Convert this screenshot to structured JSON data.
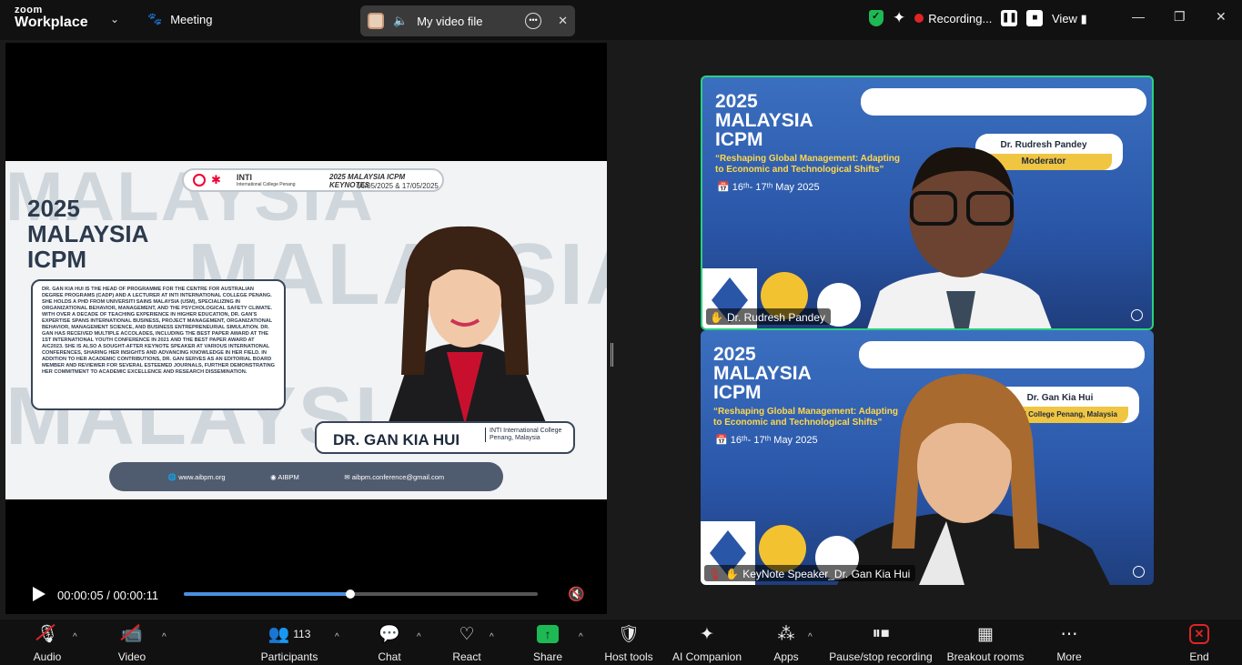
{
  "app": {
    "brand_top": "zoom",
    "brand_main": "Workplace",
    "meeting_label": "Meeting"
  },
  "video_file": {
    "title": "My video file"
  },
  "recording": {
    "label": "Recording..."
  },
  "view_label": "View",
  "main_slide": {
    "year": "2025",
    "line1": "MALAYSIA",
    "line2": "ICPM",
    "bg_word": "MALAYSIA",
    "header_org": "INTI",
    "header_org_sub": "International College Penang",
    "header_title": "2025 MALAYSIA ICPM KEYNOTES",
    "header_dates": "16/05/2025 & 17/05/2025",
    "bio": "DR. GAN KIA HUI IS THE HEAD OF PROGRAMME FOR THE CENTRE FOR AUSTRALIAN DEGREE PROGRAMS (CADP) AND A LECTURER AT INTI INTERNATIONAL COLLEGE PENANG. SHE HOLDS A PHD FROM UNIVERSITI SAINS MALAYSIA (USM), SPECIALIZING IN ORGANIZATIONAL BEHAVIOR, MANAGEMENT, AND THE PSYCHOLOGICAL SAFETY CLIMATE. WITH OVER A DECADE OF TEACHING EXPERIENCE IN HIGHER EDUCATION, DR. GAN'S EXPERTISE SPANS INTERNATIONAL BUSINESS, PROJECT MANAGEMENT, ORGANIZATIONAL BEHAVIOR, MANAGEMENT SCIENCE, AND BUSINESS ENTREPRENEURIAL SIMULATION. DR. GAN HAS RECEIVED MULTIPLE ACCOLADES, INCLUDING THE BEST PAPER AWARD AT THE 1ST INTERNATIONAL YOUTH CONFERENCE IN 2021 AND THE BEST PAPER AWARD AT AIC2023. SHE IS ALSO A SOUGHT-AFTER KEYNOTE SPEAKER AT VARIOUS INTERNATIONAL CONFERENCES, SHARING HER INSIGHTS AND ADVANCING KNOWLEDGE IN HER FIELD. IN ADDITION TO HER ACADEMIC CONTRIBUTIONS, DR. GAN SERVES AS AN EDITORIAL BOARD MEMBER AND REVIEWER FOR SEVERAL ESTEEMED JOURNALS, FURTHER DEMONSTRATING HER COMMITMENT TO ACADEMIC EXCELLENCE AND RESEARCH DISSEMINATION.",
    "speaker_name": "DR. GAN KIA HUI",
    "speaker_affiliation": "INTI International College Penang, Malaysia",
    "footer_web": "www.aibpm.org",
    "footer_social": "AIBPM",
    "footer_email": "aibpm.conference@gmail.com"
  },
  "playback": {
    "time": "00:00:05 / 00:00:11",
    "progress": 0.47
  },
  "tiles": [
    {
      "year": "2025",
      "line1": "MALAYSIA",
      "line2": "ICPM",
      "theme": "“Reshaping Global Management: Adapting to Economic and Technological Shifts”",
      "date_text": "16ᵗʰ- 17ᵗʰ May 2025",
      "plate_name": "Dr. Rudresh Pandey",
      "plate_role": "Moderator",
      "participant_name": "Dr. Rudresh Pandey"
    },
    {
      "year": "2025",
      "line1": "MALAYSIA",
      "line2": "ICPM",
      "theme": "“Reshaping Global Management: Adapting to Economic and Technological Shifts”",
      "date_text": "16ᵗʰ- 17ᵗʰ May 2025",
      "plate_name": "Dr. Gan Kia Hui",
      "plate_role": "ational College Penang, Malaysia",
      "participant_name": "KeyNote Speaker_Dr. Gan Kia Hui"
    }
  ],
  "toolbar": {
    "audio": "Audio",
    "video": "Video",
    "participants": "Participants",
    "participants_count": "113",
    "chat": "Chat",
    "react": "React",
    "share": "Share",
    "host_tools": "Host tools",
    "ai_companion": "AI Companion",
    "apps": "Apps",
    "pause_stop_recording": "Pause/stop recording",
    "breakout_rooms": "Breakout rooms",
    "more": "More",
    "end": "End"
  },
  "colors": {
    "accent_green": "#28d07f",
    "record_red": "#e02424",
    "progress_blue": "#4a90e2"
  }
}
